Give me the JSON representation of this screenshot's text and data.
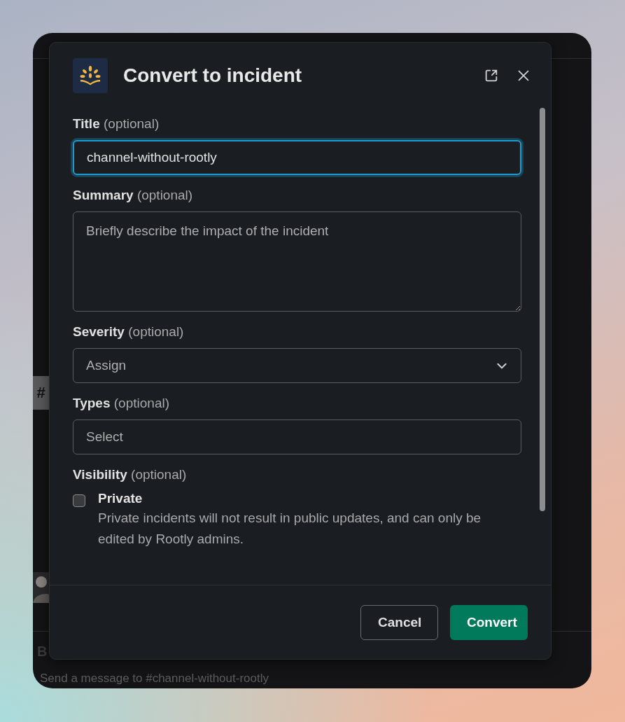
{
  "background": {
    "channel_icon": "#",
    "message_initial": "B",
    "composer_placeholder": "Send a message to #channel-without-rootly"
  },
  "dialog": {
    "title": "Convert to incident",
    "fields": [
      {
        "kind": "text",
        "label": "Title",
        "hint": "(optional)",
        "value": "channel-without-rootly",
        "focused": true
      },
      {
        "kind": "textarea",
        "label": "Summary",
        "hint": "(optional)",
        "placeholder": "Briefly describe the impact of the incident",
        "focused": false
      },
      {
        "kind": "select",
        "label": "Severity",
        "hint": "(optional)",
        "placeholder": "Assign",
        "focused": false
      },
      {
        "kind": "multiselect",
        "label": "Types",
        "hint": "(optional)",
        "placeholder": "Select",
        "focused": false
      },
      {
        "kind": "checkbox",
        "label": "Visibility",
        "hint": "(optional)",
        "option": "Private",
        "description": "Private incidents will not result in public updates, and can only be edited by Rootly admins.",
        "checked": false
      }
    ],
    "buttons": [
      {
        "label": "Cancel",
        "kind": "secondary"
      },
      {
        "label": "Convert",
        "kind": "primary"
      }
    ]
  }
}
